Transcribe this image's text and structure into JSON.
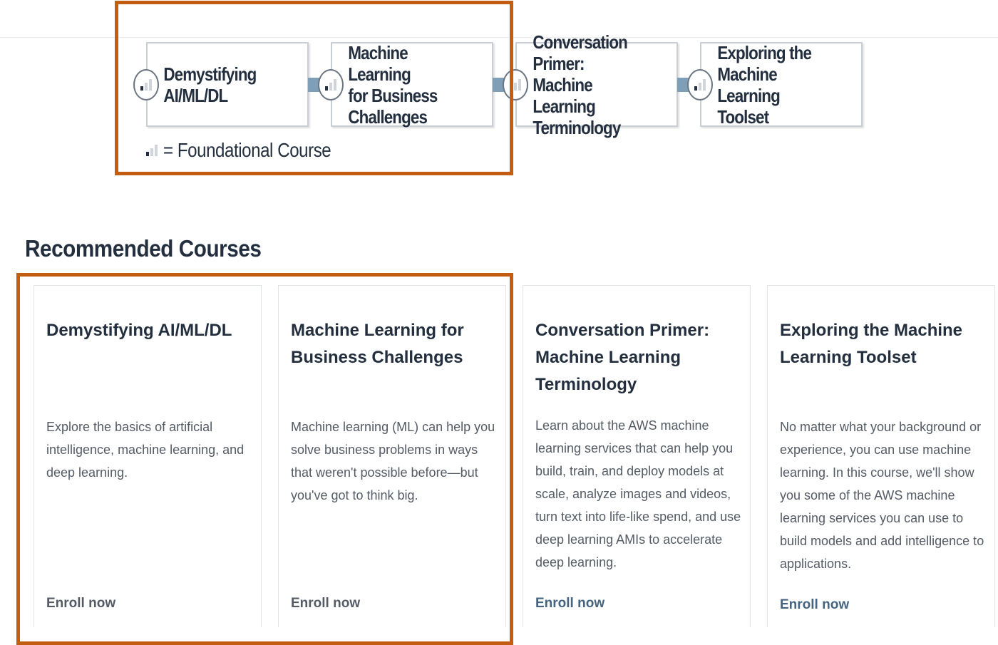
{
  "learning_path": {
    "courses": [
      {
        "title": "Demystifying\nAI/ML/DL"
      },
      {
        "title": "Machine Learning\nfor Business\nChallenges"
      },
      {
        "title": "Conversation Primer:\nMachine Learning\nTerminology"
      },
      {
        "title": "Exploring the\nMachine Learning\nToolset"
      }
    ],
    "legend_text": "= Foundational Course",
    "level_icon": "foundational-level-bars-icon"
  },
  "recommended": {
    "heading": "Recommended Courses",
    "cards": [
      {
        "title": "Demystifying AI/ML/DL",
        "description": "Explore the basics of artificial intelligence, machine learning, and deep learning.",
        "cta": "Enroll now"
      },
      {
        "title": "Machine Learning for Business Challenges",
        "description": "Machine learning (ML) can help you solve business problems in ways that weren't possible before—but you've got to think big.",
        "cta": "Enroll now"
      },
      {
        "title": "Conversation Primer: Machine Learning Terminology",
        "description": "Learn about the AWS machine learning services that can help you build, train, and deploy models at scale, analyze images and videos, turn text into life-like spend, and use deep learning AMIs to accelerate deep learning.",
        "cta": "Enroll now"
      },
      {
        "title": "Exploring the Machine Learning Toolset",
        "description": "No matter what your background or experience, you can use machine learning. In this course, we'll show you some of the AWS machine learning services you can use to build models and add intelligence to applications.",
        "cta": "Enroll now"
      }
    ]
  },
  "colors": {
    "highlight": "#c45c11",
    "connector": "#7f9fb8",
    "text_dark": "#232f3e",
    "text_body": "#545b64",
    "link": "#44647f"
  }
}
